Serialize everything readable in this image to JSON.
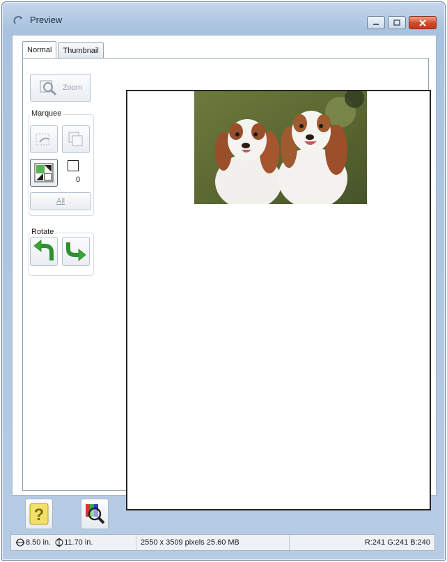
{
  "window": {
    "title": "Preview",
    "title_icon": "scanner-preview-icon",
    "buttons": [
      "minimize-icon",
      "maximize-icon",
      "close-icon"
    ]
  },
  "tabs": [
    {
      "label": "Normal",
      "active": true
    },
    {
      "label": "Thumbnail",
      "active": false
    }
  ],
  "toolbar": {
    "zoom_label": "Zoom",
    "marquee_label": "Marquee",
    "marquee_count": "0",
    "all_label": "All",
    "rotate_label": "Rotate"
  },
  "preview": {
    "image_subject": "two-cavalier-spaniels-photo"
  },
  "status": {
    "width": "8.50 in.",
    "height": "11.70 in.",
    "pixels": "2550 x 3509 pixels 25.60 MB",
    "rgb": "R:241 G:241 B:240"
  },
  "colors": {
    "title_gradient": "#a9c2de",
    "close_red": "#d04a2a",
    "rotate_green": "#3aa53a",
    "help_yellow": "#f3e06a"
  }
}
